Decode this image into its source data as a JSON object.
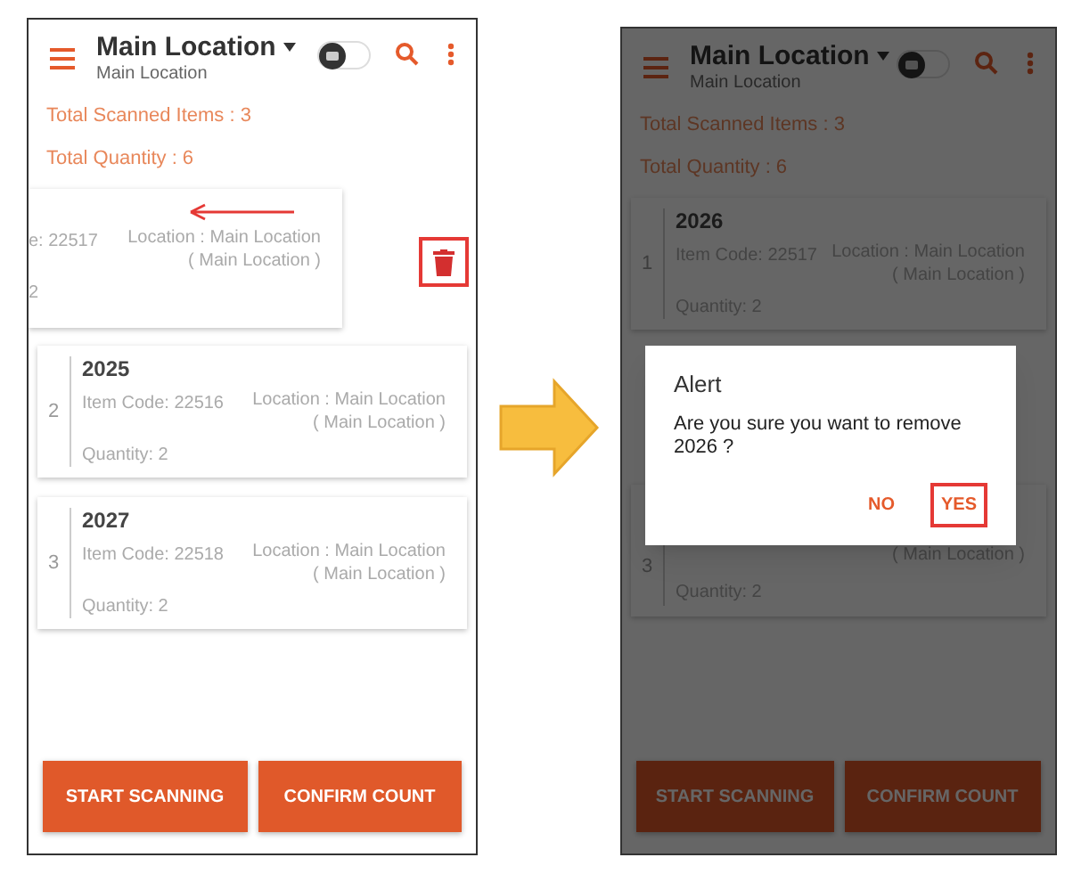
{
  "screens": [
    {
      "dimmed": false,
      "header": {
        "title": "Main Location",
        "subtitle": "Main Location",
        "camera_on": false
      },
      "totals": [
        "Total Scanned Items : 3",
        "Total Quantity : 6"
      ],
      "items": [
        {
          "kind": "swiped",
          "code": "e: 22517",
          "location": "Location : Main Location",
          "sublocation": "( Main Location )",
          "quantity": "2"
        },
        {
          "kind": "full",
          "index": "2",
          "name": "2025",
          "code": "Item Code: 22516",
          "location": "Location : Main Location",
          "sublocation": "( Main Location )",
          "quantity": "Quantity: 2"
        },
        {
          "kind": "full",
          "index": "3",
          "name": "2027",
          "code": "Item Code: 22518",
          "location": "Location : Main Location",
          "sublocation": "( Main Location )",
          "quantity": "Quantity: 2"
        }
      ],
      "buttons": [
        "START SCANNING",
        "CONFIRM COUNT"
      ]
    },
    {
      "dimmed": true,
      "header": {
        "title": "Main Location",
        "subtitle": "Main Location",
        "camera_on": false
      },
      "totals": [
        "Total Scanned Items : 3",
        "Total Quantity : 6"
      ],
      "items": [
        {
          "kind": "full",
          "index": "1",
          "name": "2026",
          "code": "Item Code: 22517",
          "location": "Location : Main Location",
          "sublocation": "( Main Location )",
          "quantity": "Quantity: 2"
        },
        {
          "kind": "covered",
          "index": "3",
          "sublocation": "( Main Location )",
          "quantity": "Quantity: 2"
        }
      ],
      "buttons": [
        "START SCANNING",
        "CONFIRM COUNT"
      ],
      "dialog": {
        "title": "Alert",
        "message": "Are you sure you want to remove 2026 ?",
        "buttons": [
          {
            "label": "NO",
            "highlighted": false
          },
          {
            "label": "YES",
            "highlighted": true
          }
        ]
      }
    }
  ]
}
